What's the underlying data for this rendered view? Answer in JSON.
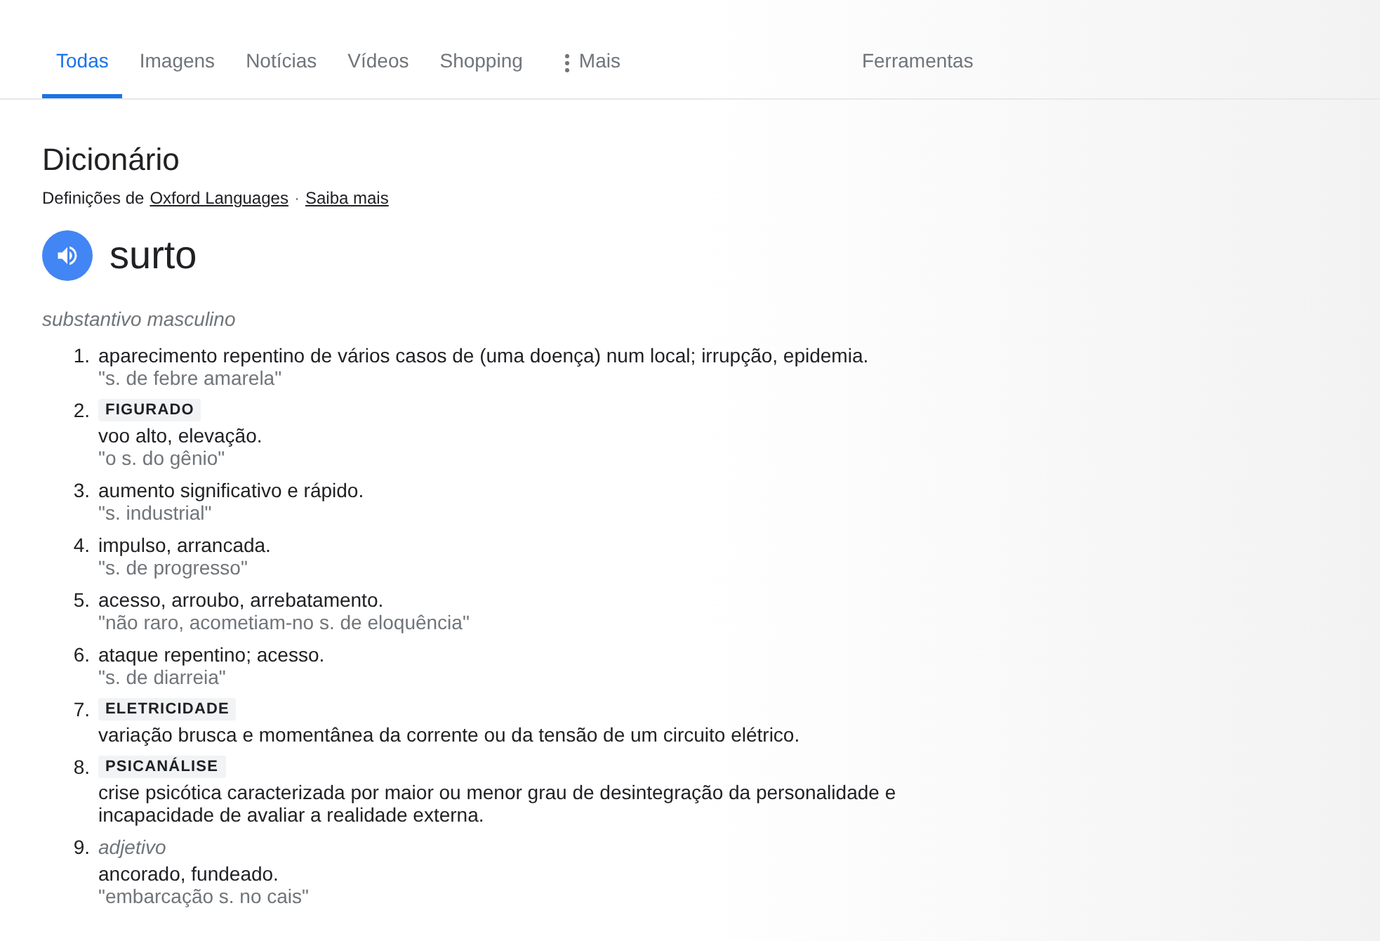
{
  "tabs": [
    {
      "label": "Todas",
      "selected": true
    },
    {
      "label": "Imagens",
      "selected": false
    },
    {
      "label": "Notícias",
      "selected": false
    },
    {
      "label": "Vídeos",
      "selected": false
    },
    {
      "label": "Shopping",
      "selected": false
    },
    {
      "label": "Mais",
      "selected": false,
      "kind": "more"
    }
  ],
  "tools": "Ferramentas",
  "dictionary": {
    "title": "Dicionário",
    "source_prefix": "Definições de",
    "source_link": "Oxford Languages",
    "separator": "·",
    "more_link": "Saiba mais",
    "word": "surto",
    "part_of_speech": "substantivo masculino",
    "definitions": [
      {
        "number": "1.",
        "text": "aparecimento repentino de vários casos de (uma doença) num local; irrupção, epidemia.",
        "example": "\"s. de febre amarela\""
      },
      {
        "number": "2.",
        "label": "FIGURADO",
        "text": "voo alto, elevação.",
        "example": "\"o s. do gênio\""
      },
      {
        "number": "3.",
        "text": "aumento significativo e rápido.",
        "example": "\"s. industrial\""
      },
      {
        "number": "4.",
        "text": "impulso, arrancada.",
        "example": "\"s. de progresso\""
      },
      {
        "number": "5.",
        "text": "acesso, arroubo, arrebatamento.",
        "example": "\"não raro, acometiam-no s. de eloquência\""
      },
      {
        "number": "6.",
        "text": "ataque repentino; acesso.",
        "example": "\"s. de diarreia\""
      },
      {
        "number": "7.",
        "label": "ELETRICIDADE",
        "text": "variação brusca e momentânea da corrente ou da tensão de um circuito elétrico."
      },
      {
        "number": "8.",
        "label": "PSICANÁLISE",
        "text": "crise psicótica caracterizada por maior ou menor grau de desintegração da personalidade e incapacidade de avaliar a realidade externa."
      },
      {
        "number": "9.",
        "part_of_speech": "adjetivo",
        "text": "ancorado, fundeado.",
        "example": "\"embarcação s. no cais\""
      }
    ]
  }
}
